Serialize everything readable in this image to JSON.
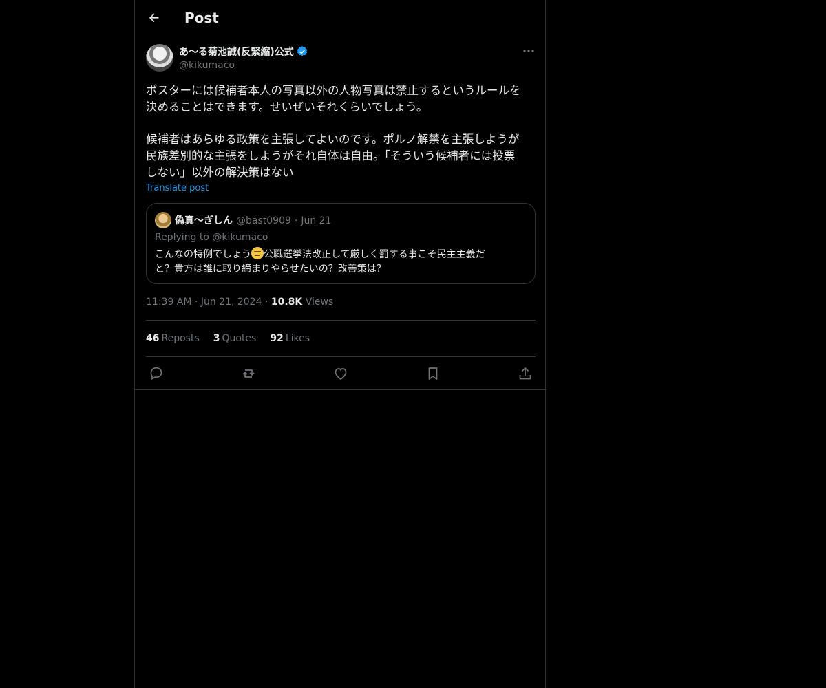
{
  "header": {
    "title": "Post",
    "back_icon": "arrow-left-icon"
  },
  "post": {
    "display_name": "あ〜る菊池誠(反緊縮)公式",
    "handle": "@kikumaco",
    "verified": true,
    "paragraph1_line1": "ポスターには候補者本人の写真以外の人物写真は禁止するというルールを",
    "paragraph1_line2": "決めることはできます。せいぜいそれくらいでしょう。",
    "paragraph2_line1": "候補者はあらゆる政策を主張してよいのです。ポルノ解禁を主張しようが",
    "paragraph2_line2": "民族差別的な主張をしようがそれ自体は自由。「そういう候補者には投票",
    "paragraph2_line3": "しない」以外の解決策はない",
    "translate_label": "Translate post",
    "time": "11:39 AM",
    "date": "Jun 21, 2024",
    "views_count": "10.8K",
    "views_label": "Views"
  },
  "quote": {
    "display_name": "偽真〜ぎしん",
    "handle": "@bast0909",
    "date": "Jun 21",
    "replying_to": "Replying to @kikumaco",
    "text_before_emoji": "こんなの特例でしょう",
    "text_after_emoji": "公職選挙法改正して厳しく罰する事こそ民主主義だ",
    "text_line2": "と？貴方は誰に取り締まりやらせたいの？改善策は？",
    "emoji": "unamused-face-emoji"
  },
  "stats": {
    "reposts_count": "46",
    "reposts_label": "Reposts",
    "quotes_count": "3",
    "quotes_label": "Quotes",
    "likes_count": "92",
    "likes_label": "Likes"
  },
  "actions": [
    "reply-icon",
    "repost-icon",
    "like-icon",
    "bookmark-icon",
    "share-icon"
  ],
  "colors": {
    "background": "#000000",
    "text": "#e7e9ea",
    "secondary": "#71767b",
    "accent": "#1d9bf0",
    "border": "#2f3336"
  }
}
